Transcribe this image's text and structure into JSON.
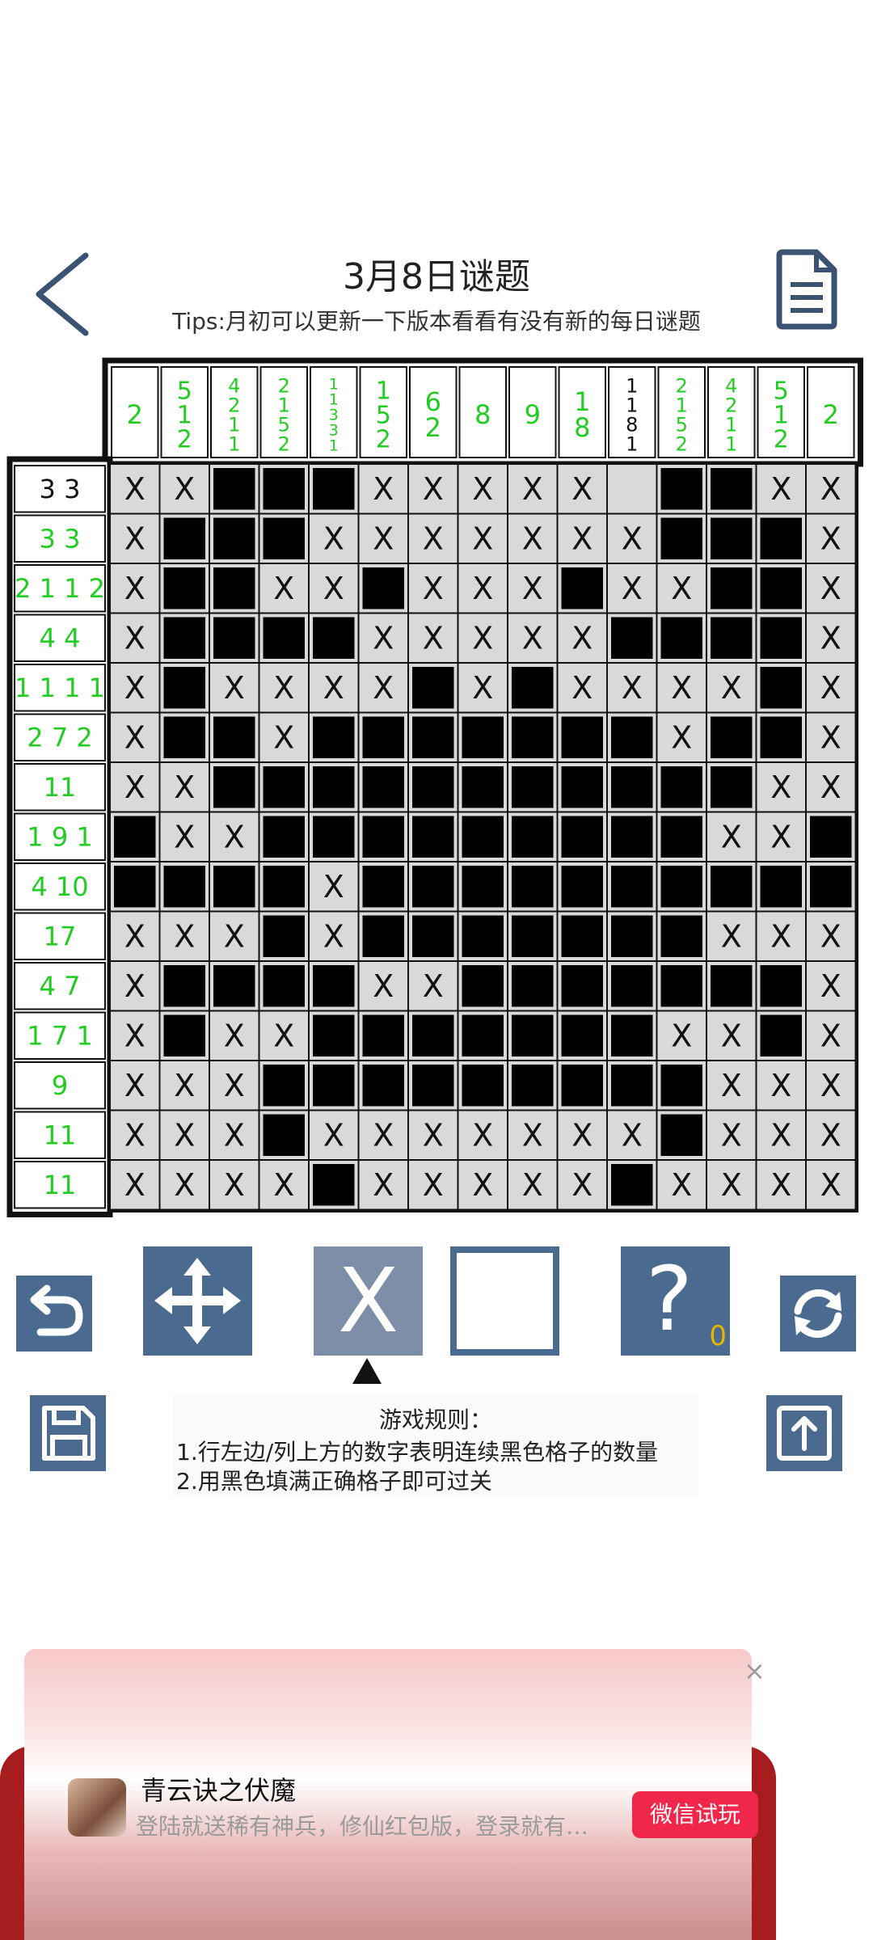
{
  "header": {
    "title": "3月8日谜题",
    "tips": "Tips:月初可以更新一下版本看看有没有新的每日谜题"
  },
  "puzzle": {
    "col_clues": [
      [
        "2"
      ],
      [
        "5",
        "1",
        "2"
      ],
      [
        "4",
        "2",
        "1",
        "1"
      ],
      [
        "2",
        "1",
        "5",
        "2"
      ],
      [
        "1",
        "1",
        "3",
        "3",
        "1"
      ],
      [
        "1",
        "5",
        "2"
      ],
      [
        "6",
        "2"
      ],
      [
        "8"
      ],
      [
        "9"
      ],
      [
        "1",
        "8"
      ],
      [
        "1",
        "1",
        "8",
        "1"
      ],
      [
        "2",
        "1",
        "5",
        "2"
      ],
      [
        "4",
        "2",
        "1",
        "1"
      ],
      [
        "5",
        "1",
        "2"
      ],
      [
        "2"
      ]
    ],
    "col_clue_colors": [
      "g",
      "g",
      "g",
      "g",
      "g",
      "g",
      "g",
      "g",
      "g",
      "g",
      "k",
      "g",
      "g",
      "g",
      "g"
    ],
    "row_clues": [
      "3 3",
      "3 3",
      "2 1 1 2",
      "4 4",
      "1 1 1 1",
      "2 7 2",
      "11",
      "1 9 1",
      "4 10",
      "17",
      "4 7",
      "1 7 1",
      "9",
      "11",
      "11"
    ],
    "row_clue_colors": [
      "k",
      "g",
      "g",
      "g",
      "g",
      "g",
      "g",
      "g",
      "g",
      "g",
      "g",
      "g",
      "g",
      "g",
      "g"
    ],
    "colors": {
      "clue_green": "#22cc22",
      "clue_black": "#111111",
      "cell_bg": "#d9d9d9",
      "filled": "#000000",
      "grid": "#111111"
    },
    "grid": [
      "XX###XXXXX.##XX",
      "X###XXXXXXX###X",
      "X##XX#XXX#XX##X",
      "X####XXXXX####X",
      "X#XXXX#X#XXXX#X",
      "X##X#######X##X",
      "XX###########XX",
      "#XX#########XX#",
      "####X##########",
      "XXX#X#######XXX",
      "X####XX#######X",
      "X#XX#######XX#X",
      "XXX#########XXX",
      "XXX#XXXXXXX#XXX",
      "XXXX#XXXXX#XXXX"
    ]
  },
  "controls": {
    "hint_count": "0",
    "undo_icon": "undo-icon",
    "move_icon": "move-arrows-icon",
    "mark_x_label": "X",
    "fill_icon": "empty-square-icon",
    "hint_label": "?",
    "refresh_icon": "refresh-icon",
    "save_icon": "save-icon",
    "share_icon": "upload-icon"
  },
  "rules": {
    "title": "游戏规则：",
    "line1": "1.行左边/列上方的数字表明连续黑色格子的数量",
    "line2": "2.用黑色填满正确格子即可过关"
  },
  "ad": {
    "name": "青云诀之伏魔",
    "desc": "登陆就送稀有神兵，修仙红包版，登录就有…",
    "button": "微信试玩",
    "close": "×"
  }
}
